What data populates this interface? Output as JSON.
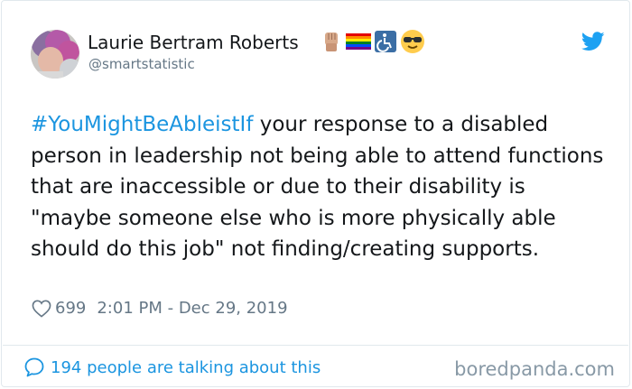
{
  "tweet": {
    "author_name": "Laurie Bertram Roberts",
    "handle": "@smartstatistic",
    "name_emojis": [
      "raised-fist-icon",
      "rainbow-flag-icon",
      "wheelchair-icon",
      "sunglasses-face-icon"
    ],
    "hashtag": "#YouMightBeAbleistIf",
    "text": " your response to a disabled person in leadership not being able to attend functions that are inaccessible or due to their disability is \"maybe someone else who is more physically able should do this job\" not finding/creating supports.",
    "likes": "699",
    "timestamp": "2:01 PM - Dec 29, 2019",
    "discussion": "194 people are talking about this"
  },
  "branding": {
    "watermark": "boredpanda.com"
  },
  "colors": {
    "link": "#1b95e0",
    "muted": "#657786",
    "twitter_blue": "#1da1f2"
  }
}
